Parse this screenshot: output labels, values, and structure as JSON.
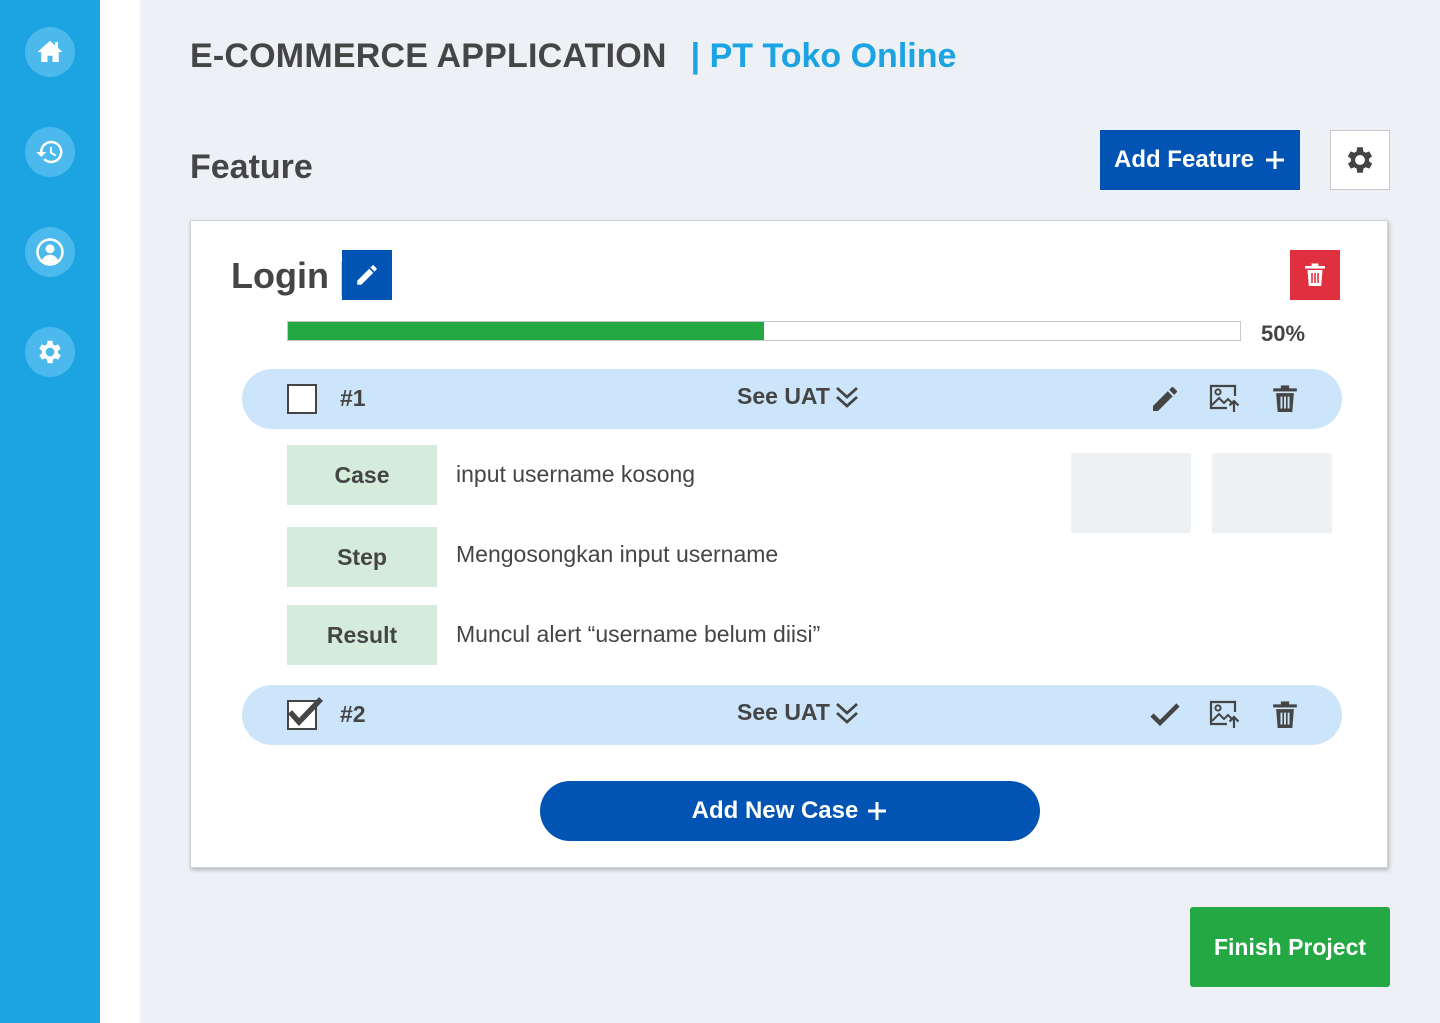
{
  "header": {
    "app_title": "E-COMMERCE APPLICATION",
    "company": "|  PT Toko Online"
  },
  "sidebar": {
    "items": [
      {
        "icon": "home-icon"
      },
      {
        "icon": "history-icon"
      },
      {
        "icon": "user-icon"
      },
      {
        "icon": "gear-icon"
      }
    ]
  },
  "page": {
    "section_title": "Feature",
    "add_feature_label": "Add Feature"
  },
  "feature": {
    "name": "Login |",
    "progress": 0.5,
    "progress_label": "50%",
    "cases": [
      {
        "number": "#1",
        "checked": false,
        "see_uat_label": "See UAT",
        "expanded": true,
        "details": {
          "case_label": "Case",
          "case_value": "input username kosong",
          "step_label": "Step",
          "step_value": "Mengosongkan input username",
          "result_label": "Result",
          "result_value": "Muncul alert “username belum diisi”"
        }
      },
      {
        "number": "#2",
        "checked": true,
        "see_uat_label": "See UAT",
        "expanded": false
      }
    ],
    "add_case_label": "Add New Case"
  },
  "footer": {
    "finish_label": "Finish Project"
  },
  "colors": {
    "sidebar": "#1ba3e2",
    "primary": "#0254b4",
    "success": "#24a843",
    "danger": "#e0303f",
    "row_bg": "#cde5fb",
    "label_bg": "#d5ecdc"
  }
}
